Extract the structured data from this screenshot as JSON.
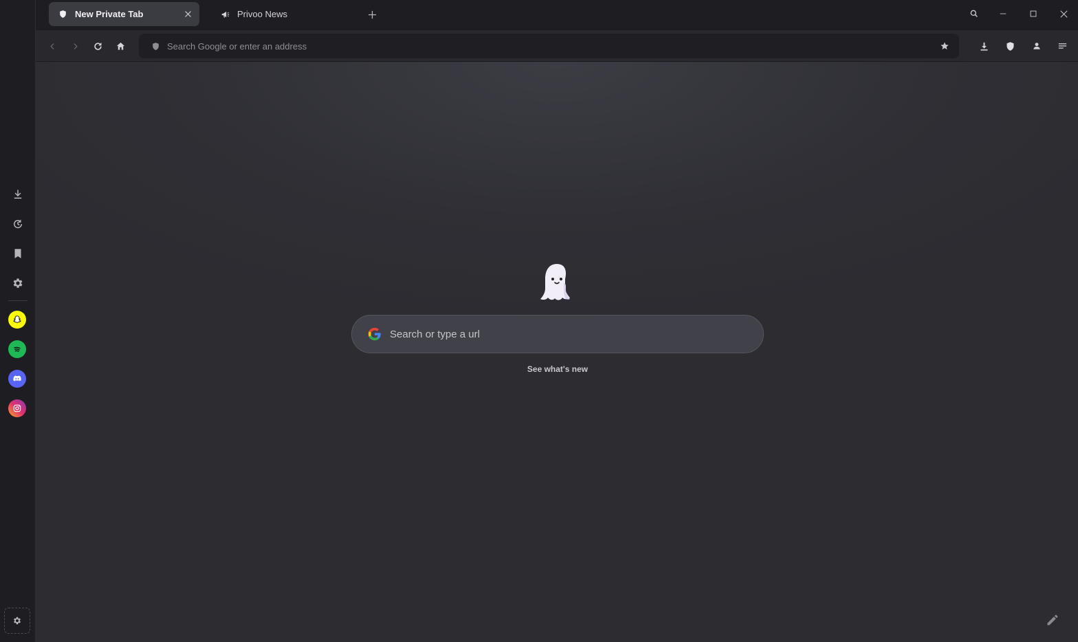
{
  "tabs": [
    {
      "label": "New Private Tab",
      "active": true,
      "icon": "shield-icon"
    },
    {
      "label": "Privoo News",
      "active": false,
      "icon": "megaphone-icon"
    }
  ],
  "toolbar": {
    "omnibox_placeholder": "Search Google or enter an address"
  },
  "new_tab_page": {
    "search_placeholder": "Search or type a url",
    "whats_new_link": "See what's new"
  },
  "sidebar": {
    "tools": [
      "download-icon",
      "history-icon",
      "bookmark-icon",
      "settings-icon"
    ],
    "apps": [
      {
        "name": "snapchat",
        "color": "#FFFC00"
      },
      {
        "name": "spotify",
        "color": "#1DB954"
      },
      {
        "name": "discord",
        "color": "#5865F2"
      },
      {
        "name": "instagram",
        "color": "#E1306C"
      }
    ]
  },
  "colors": {
    "background": "#2b2b30",
    "sidebar": "#1e1e22",
    "active_tab": "#3b3b42",
    "omnibox": "#1f1f23",
    "search_box": "#414149"
  }
}
